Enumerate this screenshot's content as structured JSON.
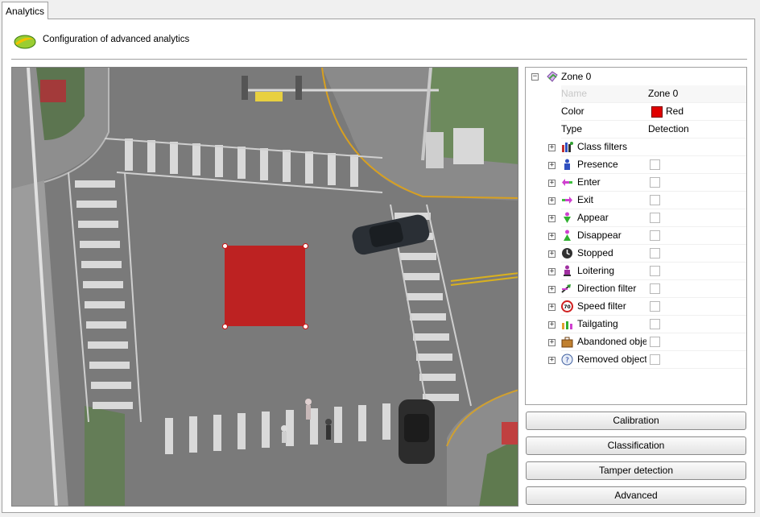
{
  "tab": {
    "label": "Analytics"
  },
  "header": {
    "title": "Configuration of advanced analytics",
    "icon": "analytics-logo-icon"
  },
  "zone": {
    "color": "#bd2222"
  },
  "tree": {
    "root_label": "Zone 0",
    "properties": [
      {
        "label": "Name",
        "value": "Zone 0"
      },
      {
        "label": "Color",
        "value": "Red",
        "swatch": "#e00000"
      },
      {
        "label": "Type",
        "value": "Detection"
      }
    ],
    "groups": [
      {
        "label": "Class filters",
        "icon": "class-filters-icon",
        "checkbox": false
      },
      {
        "label": "Presence",
        "icon": "presence-icon",
        "checkbox": true
      },
      {
        "label": "Enter",
        "icon": "enter-icon",
        "checkbox": true
      },
      {
        "label": "Exit",
        "icon": "exit-icon",
        "checkbox": true
      },
      {
        "label": "Appear",
        "icon": "appear-icon",
        "checkbox": true
      },
      {
        "label": "Disappear",
        "icon": "disappear-icon",
        "checkbox": true
      },
      {
        "label": "Stopped",
        "icon": "stopped-icon",
        "checkbox": true
      },
      {
        "label": "Loitering",
        "icon": "loitering-icon",
        "checkbox": true
      },
      {
        "label": "Direction filter",
        "icon": "direction-icon",
        "checkbox": true
      },
      {
        "label": "Speed filter",
        "icon": "speed-icon",
        "checkbox": true
      },
      {
        "label": "Tailgating",
        "icon": "tailgating-icon",
        "checkbox": true
      },
      {
        "label": "Abandoned objects",
        "icon": "abandoned-icon",
        "checkbox": true
      },
      {
        "label": "Removed objects",
        "icon": "removed-icon",
        "checkbox": true
      }
    ]
  },
  "buttons": {
    "calibration": "Calibration",
    "classification": "Classification",
    "tamper": "Tamper detection",
    "advanced": "Advanced"
  }
}
